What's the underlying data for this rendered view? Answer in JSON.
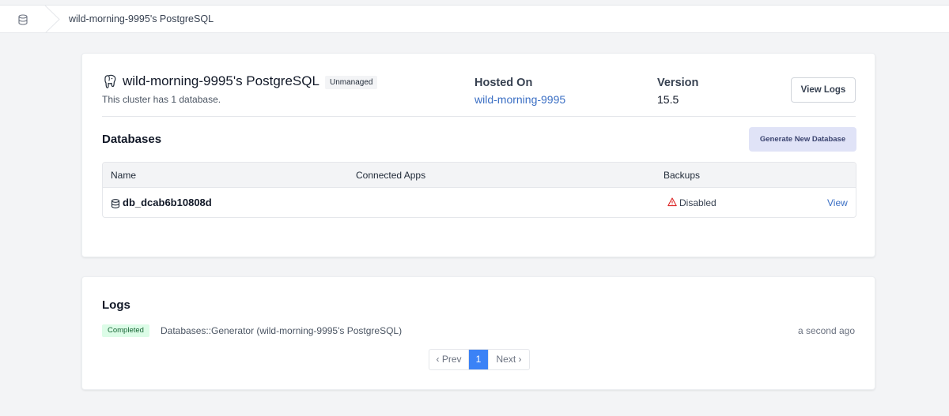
{
  "breadcrumb": {
    "current": "wild-morning-9995's PostgreSQL"
  },
  "cluster": {
    "title": "wild-morning-9995's PostgreSQL",
    "badge": "Unmanaged",
    "subtitle": "This cluster has 1 database.",
    "hosted_label": "Hosted On",
    "hosted_value": "wild-morning-9995",
    "version_label": "Version",
    "version_value": "15.5",
    "view_logs_label": "View Logs"
  },
  "databases": {
    "heading": "Databases",
    "generate_label": "Generate New Database",
    "columns": [
      "Name",
      "Connected Apps",
      "Backups"
    ],
    "rows": [
      {
        "name": "db_dcab6b10808d",
        "connected_apps": "",
        "backups": "Disabled",
        "action": "View"
      }
    ]
  },
  "logs": {
    "heading": "Logs",
    "entries": [
      {
        "status": "Completed",
        "text": "Databases::Generator (wild-morning-9995's PostgreSQL)",
        "time": "a second ago"
      }
    ],
    "pagination": {
      "prev": "‹ Prev",
      "current": "1",
      "next": "Next ›"
    }
  },
  "icons": {
    "home": "database-stack-icon",
    "cluster": "postgresql-elephant-icon",
    "row": "database-icon",
    "backup": "warning-triangle-icon"
  },
  "colors": {
    "link": "#3b6fc4",
    "primary": "#3b82f6",
    "completed_bg": "#dcfce7",
    "warning": "#dc2626"
  }
}
